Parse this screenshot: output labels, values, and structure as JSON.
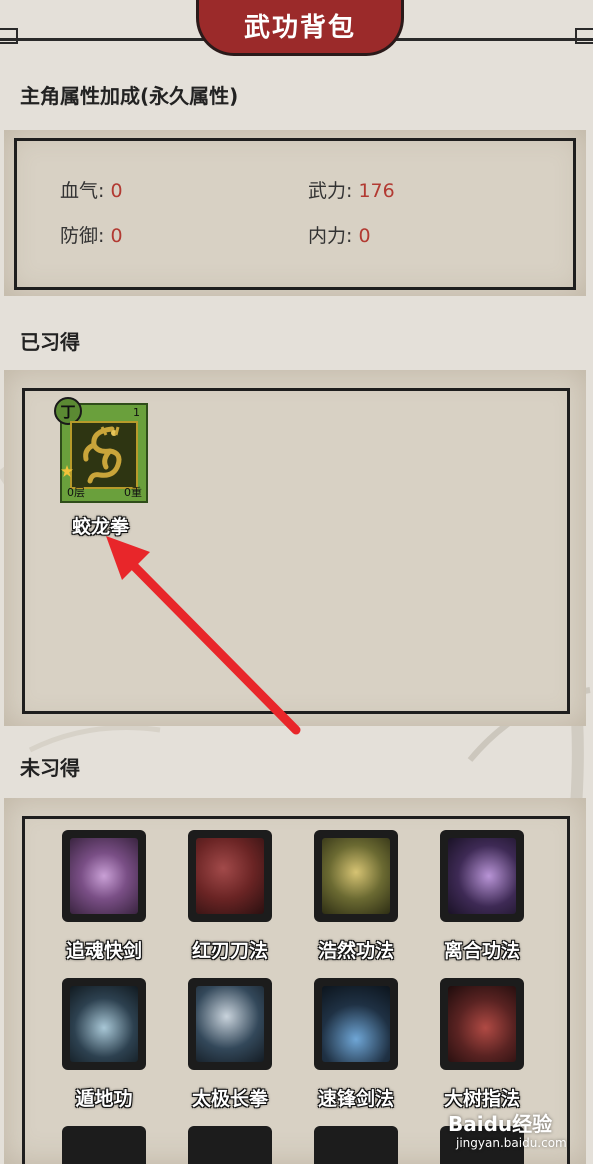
{
  "header": {
    "title": "武功背包"
  },
  "attributes": {
    "section_title": "主角属性加成(永久属性)",
    "items": [
      {
        "label": "血气:",
        "value": "0"
      },
      {
        "label": "武力:",
        "value": "176"
      },
      {
        "label": "防御:",
        "value": "0"
      },
      {
        "label": "内力:",
        "value": "0"
      }
    ]
  },
  "learned": {
    "section_title": "已习得",
    "skills": [
      {
        "name": "蛟龙拳",
        "grade": "丁",
        "level": "1",
        "layer": "0层",
        "stack": "0重",
        "card_color": "#6aa03c"
      }
    ]
  },
  "unlearned": {
    "section_title": "未习得",
    "skills": [
      {
        "name": "追魂快剑",
        "icon": "purple-feather-icon",
        "color": "#7a4f86"
      },
      {
        "name": "红刃刀法",
        "icon": "red-blade-icon",
        "color": "#6a2424"
      },
      {
        "name": "浩然功法",
        "icon": "golden-flower-icon",
        "color": "#6b6a32"
      },
      {
        "name": "离合功法",
        "icon": "violet-slash-icon",
        "color": "#3e2a55"
      },
      {
        "name": "遁地功",
        "icon": "earth-ring-icon",
        "color": "#2d4150"
      },
      {
        "name": "太极长拳",
        "icon": "taiji-fighter-icon",
        "color": "#33485a"
      },
      {
        "name": "速锋剑法",
        "icon": "blue-sword-icon",
        "color": "#1f3144"
      },
      {
        "name": "大树指法",
        "icon": "red-vortex-icon",
        "color": "#5a2322"
      }
    ]
  },
  "watermark": {
    "text": "Baidu经验",
    "sub": "jingyan.baidu.com"
  }
}
